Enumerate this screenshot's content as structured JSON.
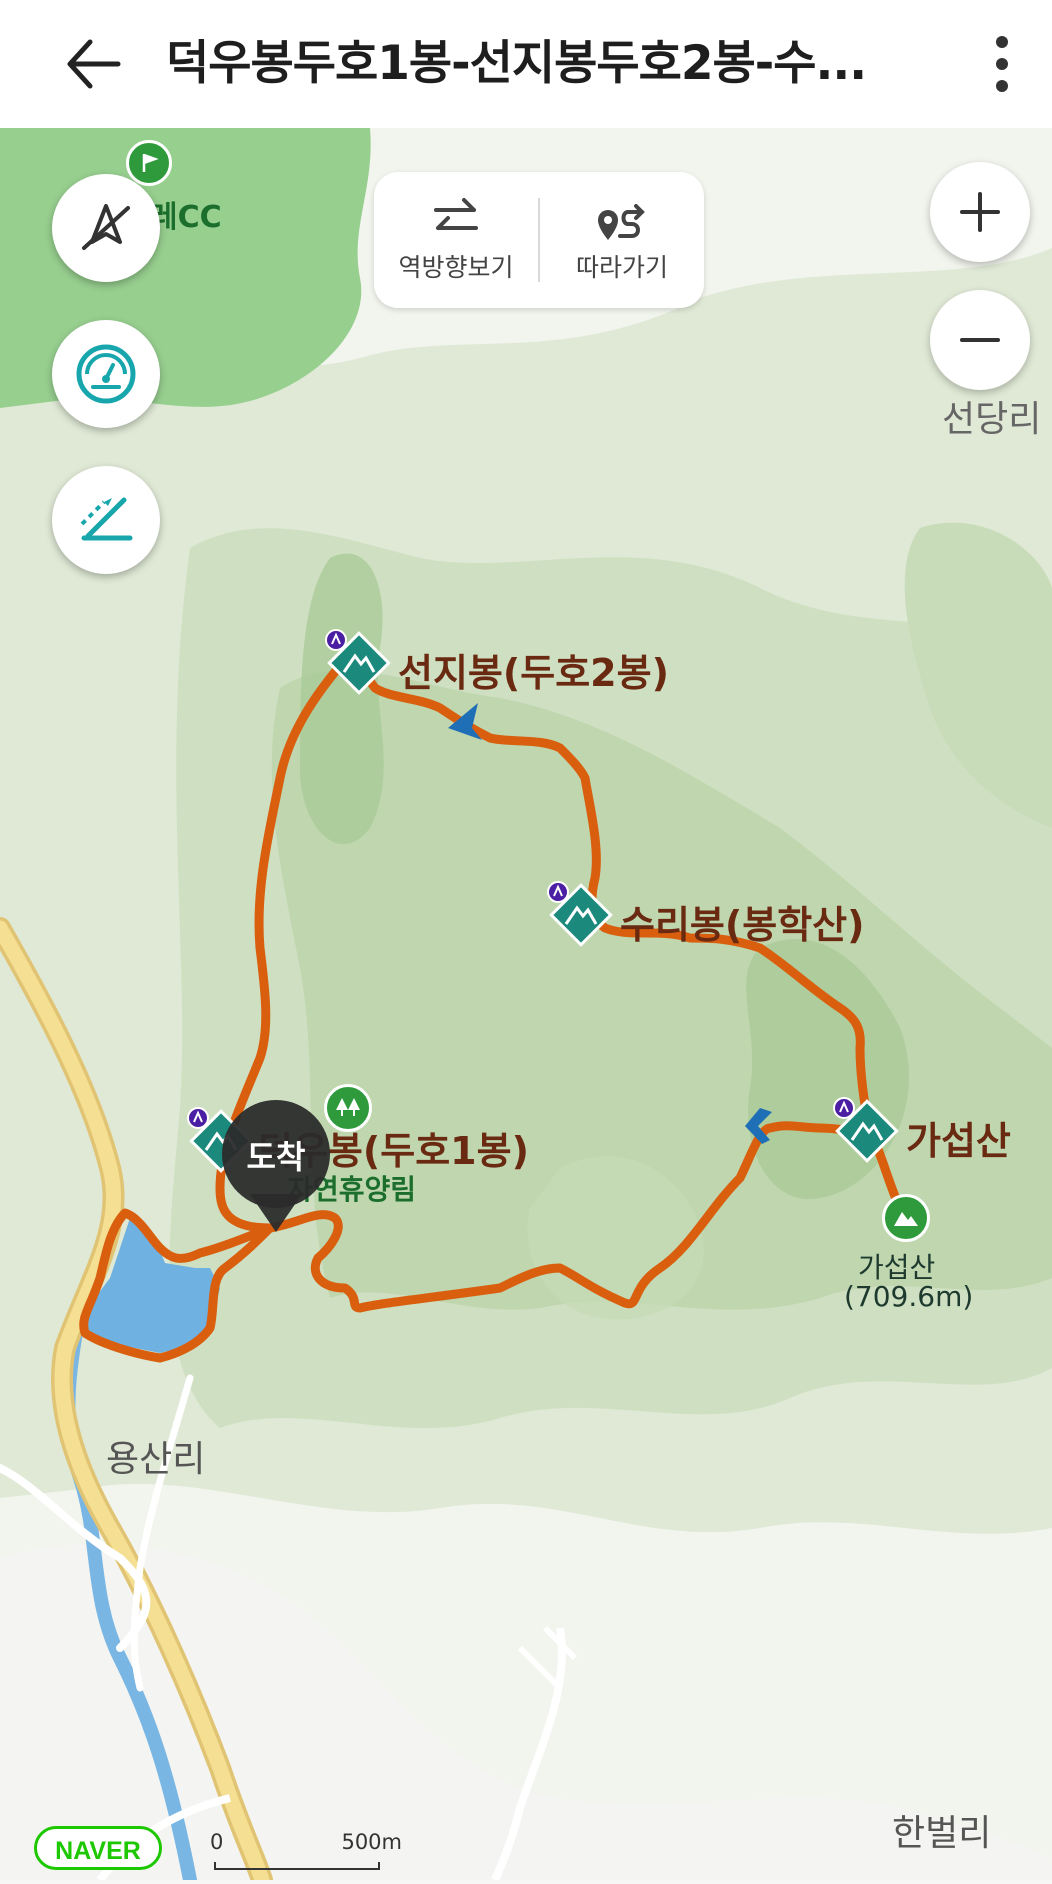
{
  "header": {
    "title": "덕우봉두호1봉-선지봉두호2봉-수..."
  },
  "toolbar": {
    "reverse_label": "역방향보기",
    "follow_label": "따라가기"
  },
  "map": {
    "places": {
      "golf_partial": "레CC",
      "seondang": "선당리",
      "yongsan": "용산리",
      "hanbeol": "한벌리",
      "forest_partial": "자연휴양림",
      "gaseop_summit_name": "가섭산",
      "gaseop_summit_elev": "(709.6m)"
    },
    "peaks": {
      "seonji": "선지봉(두호2봉)",
      "suri": "수리봉(봉학산)",
      "gaseop": "가섭산",
      "deogu": "덕우봉(두호1봉)"
    },
    "arrival_label": "도착",
    "scale": {
      "zero": "0",
      "distance": "500m"
    },
    "brand": "NAVER"
  },
  "colors": {
    "route": "#d95f0e",
    "peak_marker": "#1b8a7c",
    "forest": "#97cf8f",
    "road": "#f3dd8d",
    "water": "#6fb1e0"
  }
}
